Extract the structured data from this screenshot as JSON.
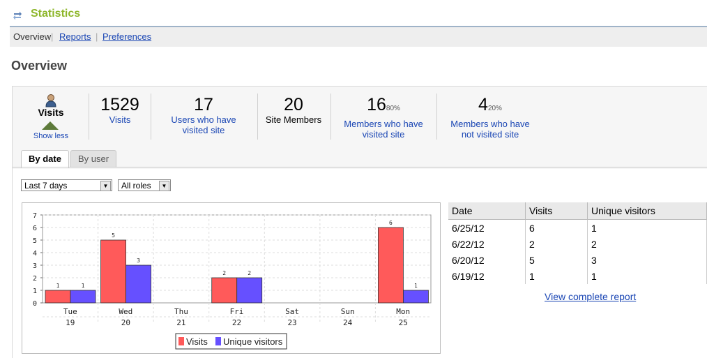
{
  "header": {
    "title": "Statistics",
    "icon": "refresh-arrows-icon"
  },
  "nav": {
    "items": [
      {
        "label": "Overview"
      },
      {
        "label": "Reports"
      },
      {
        "label": "Preferences"
      }
    ]
  },
  "page_title": "Overview",
  "summary": {
    "visits_label": "Visits",
    "show_less": "Show less",
    "stats": [
      {
        "value": "1529",
        "pct": "",
        "label1": "Visits",
        "label2": ""
      },
      {
        "value": "17",
        "pct": "",
        "label1": "Users who have",
        "label2": "visited site"
      },
      {
        "value": "20",
        "pct": "",
        "label1": "Site Members",
        "label2": ""
      },
      {
        "value": "16",
        "pct": "80%",
        "label1": "Members who have",
        "label2": "visited site"
      },
      {
        "value": "4",
        "pct": "20%",
        "label1": "Members who have",
        "label2": "not visited site"
      }
    ]
  },
  "tabs": [
    {
      "label": "By date"
    },
    {
      "label": "By user"
    }
  ],
  "filters": {
    "range": "Last 7 days",
    "roles": "All roles"
  },
  "chart_data": {
    "type": "bar",
    "categories": [
      "Tue",
      "Wed",
      "Thu",
      "Fri",
      "Sat",
      "Sun",
      "Mon"
    ],
    "sub_categories": [
      "19",
      "20",
      "21",
      "22",
      "23",
      "24",
      "25"
    ],
    "series": [
      {
        "name": "Visits",
        "color": "#ff5a5a",
        "values": [
          1,
          5,
          0,
          2,
          0,
          0,
          6
        ]
      },
      {
        "name": "Unique visitors",
        "color": "#6650ff",
        "values": [
          1,
          3,
          0,
          2,
          0,
          0,
          1
        ]
      }
    ],
    "ylim": [
      0,
      7
    ],
    "yticks": [
      0,
      1,
      2,
      3,
      4,
      5,
      6,
      7
    ],
    "grid": true,
    "legend": "bottom"
  },
  "table": {
    "headers": [
      "Date",
      "Visits",
      "Unique visitors"
    ],
    "rows": [
      [
        "6/25/12",
        "6",
        "1"
      ],
      [
        "6/22/12",
        "2",
        "2"
      ],
      [
        "6/20/12",
        "5",
        "3"
      ],
      [
        "6/19/12",
        "1",
        "1"
      ]
    ]
  },
  "view_report": "View complete report"
}
